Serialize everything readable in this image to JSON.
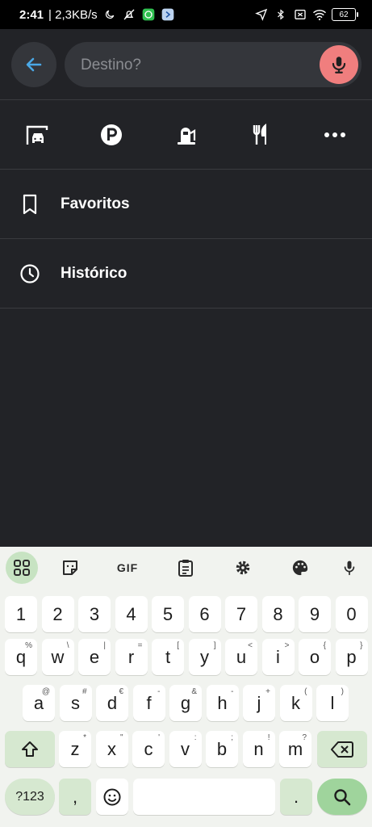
{
  "status_bar": {
    "time": "2:41",
    "speed": "| 2,3KB/s",
    "battery": "62",
    "icons": [
      "moon-icon",
      "mute-icon",
      "whatsapp-icon",
      "app-icon",
      "location-icon",
      "bluetooth-icon",
      "sim-icon",
      "wifi-icon",
      "battery-icon"
    ]
  },
  "search": {
    "placeholder": "Destino?",
    "value": ""
  },
  "categories": [
    "car-wash-icon",
    "parking-icon",
    "fuel-icon",
    "restaurant-icon",
    "more-icon"
  ],
  "list": [
    {
      "label": "Favoritos",
      "icon": "bookmark-icon"
    },
    {
      "label": "Histórico",
      "icon": "clock-icon"
    }
  ],
  "keyboard": {
    "toolbar": {
      "gif": "GIF"
    },
    "row_numbers": [
      "1",
      "2",
      "3",
      "4",
      "5",
      "6",
      "7",
      "8",
      "9",
      "0"
    ],
    "row1": [
      {
        "k": "q",
        "h": "%"
      },
      {
        "k": "w",
        "h": "\\"
      },
      {
        "k": "e",
        "h": "|"
      },
      {
        "k": "r",
        "h": "="
      },
      {
        "k": "t",
        "h": "["
      },
      {
        "k": "y",
        "h": "]"
      },
      {
        "k": "u",
        "h": "<"
      },
      {
        "k": "i",
        "h": ">"
      },
      {
        "k": "o",
        "h": "{"
      },
      {
        "k": "p",
        "h": "}"
      }
    ],
    "row2": [
      {
        "k": "a",
        "h": "@"
      },
      {
        "k": "s",
        "h": "#"
      },
      {
        "k": "d",
        "h": "€"
      },
      {
        "k": "f",
        "h": "-"
      },
      {
        "k": "g",
        "h": "&"
      },
      {
        "k": "h",
        "h": "-"
      },
      {
        "k": "j",
        "h": "+"
      },
      {
        "k": "k",
        "h": "("
      },
      {
        "k": "l",
        "h": ")"
      }
    ],
    "row3": [
      {
        "k": "z",
        "h": "*"
      },
      {
        "k": "x",
        "h": "\""
      },
      {
        "k": "c",
        "h": "'"
      },
      {
        "k": "v",
        "h": ":"
      },
      {
        "k": "b",
        "h": ";"
      },
      {
        "k": "n",
        "h": "!"
      },
      {
        "k": "m",
        "h": "?"
      }
    ],
    "symbols_label": "?123",
    "comma": ",",
    "period": "."
  },
  "colors": {
    "background": "#222327",
    "accent_blue": "#4aa8e6",
    "mic_red": "#f07e7e",
    "keyboard_green": "#9fd49c"
  }
}
